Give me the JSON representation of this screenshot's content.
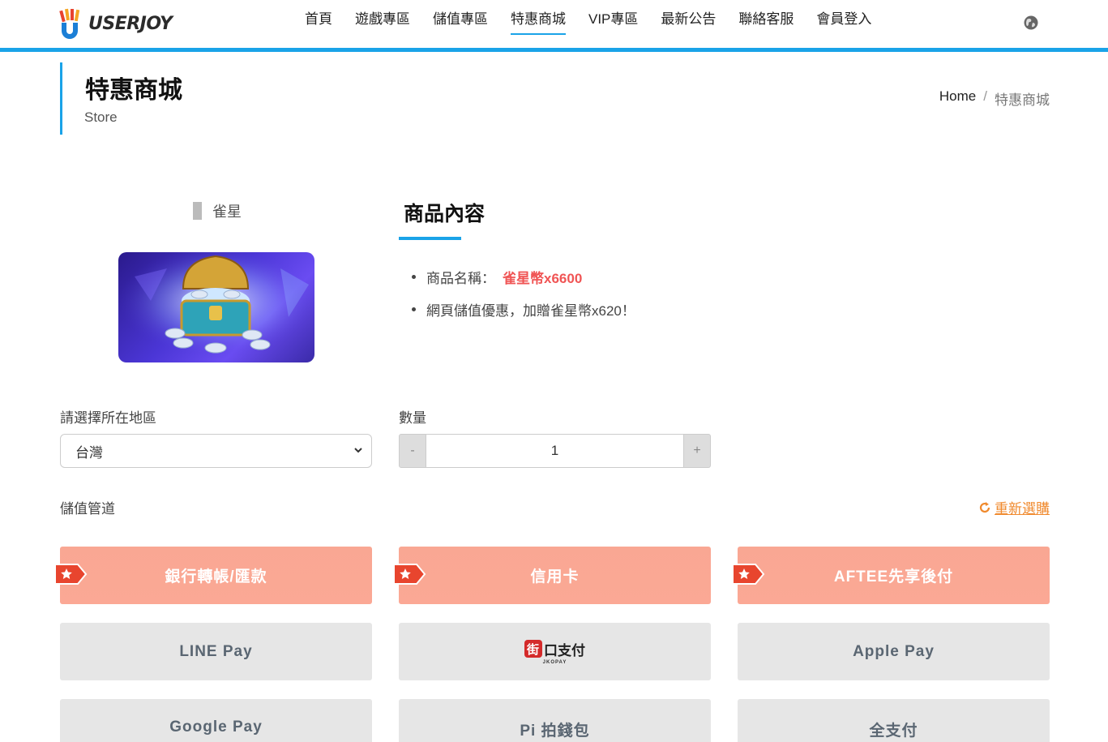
{
  "brand": {
    "name": "USERJOY"
  },
  "nav": [
    {
      "label": "首頁",
      "active": false
    },
    {
      "label": "遊戲專區",
      "active": false
    },
    {
      "label": "儲值專區",
      "active": false
    },
    {
      "label": "特惠商城",
      "active": true
    },
    {
      "label": "VIP專區",
      "active": false
    },
    {
      "label": "最新公告",
      "active": false
    },
    {
      "label": "聯絡客服",
      "active": false
    },
    {
      "label": "會員登入",
      "active": false
    }
  ],
  "page": {
    "title": "特惠商城",
    "subtitle": "Store"
  },
  "breadcrumb": {
    "home": "Home",
    "separator": "/",
    "current": "特惠商城"
  },
  "product": {
    "game": "雀星",
    "content_title": "商品內容",
    "name_label": "商品名稱：",
    "name": "雀星幣x6600",
    "promo": "網頁儲值優惠，加贈雀星幣x620！"
  },
  "form": {
    "region_label": "請選擇所在地區",
    "region_value": "台灣",
    "quantity_label": "數量",
    "quantity_value": "1",
    "minus": "-",
    "plus": "+",
    "channel_label": "儲值管道",
    "reselect": "重新選購"
  },
  "payments": {
    "bank": "銀行轉帳/匯款",
    "credit": "信用卡",
    "aftee": "AFTEE先享後付",
    "linepay": "LINE Pay",
    "jko_mark": "街",
    "jko_text": "口支付",
    "jko_sub": "JKOPAY",
    "applepay": "Apple Pay",
    "googlepay": "Google Pay",
    "pi": "Pi 拍錢包",
    "allpay": "全支付"
  },
  "colors": {
    "accent": "#1aa3e8",
    "hot": "#fba895",
    "price": "#f05454",
    "reselect": "#f08a2e"
  }
}
